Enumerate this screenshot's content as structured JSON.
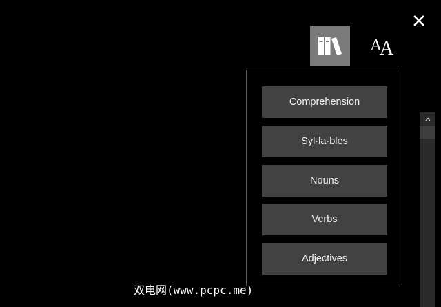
{
  "toolbar": {
    "close_icon": "close-icon",
    "grammar_icon": "books-icon",
    "text_options_icon": "font-size-icon",
    "text_options_glyph": "AA",
    "active_color": "#7a7a7a"
  },
  "grammar_panel": {
    "options": [
      {
        "label": "Comprehension"
      },
      {
        "label": "Syl·la·bles"
      },
      {
        "label": "Nouns"
      },
      {
        "label": "Verbs"
      },
      {
        "label": "Adjectives"
      }
    ]
  },
  "scrollbar": {
    "up_glyph": "^"
  },
  "watermark": {
    "text": "双电网(www.pcpc.me)"
  }
}
